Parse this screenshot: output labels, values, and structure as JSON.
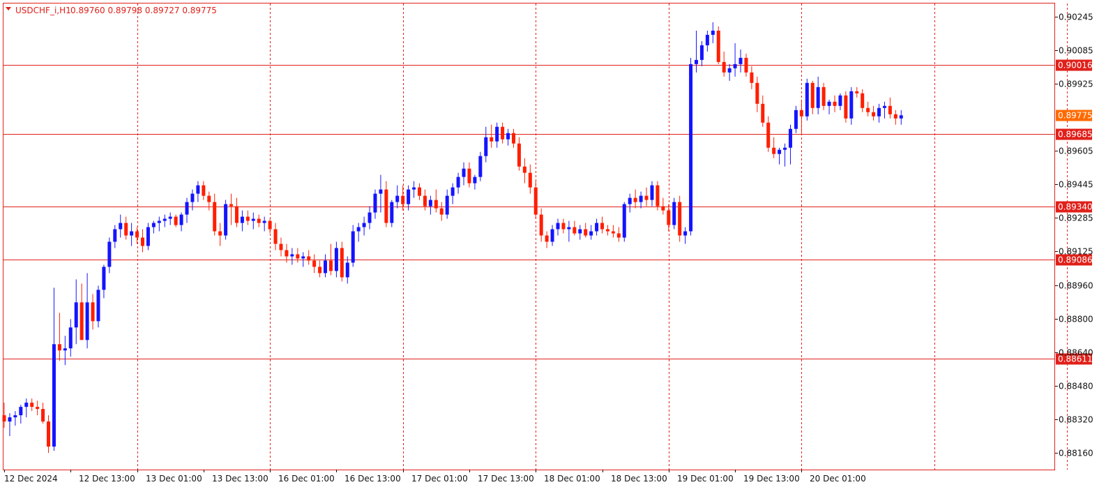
{
  "header": {
    "symbol": "USDCHF_i,H1",
    "ohlc": "0.89760 0.89798 0.89727 0.89775"
  },
  "colors": {
    "frame": "#e0201a",
    "grid": "#e0201a",
    "bull": "#1414ff",
    "bear": "#ff1e00",
    "label_text": "#ffffff",
    "background": "#ffffff"
  },
  "chart_data": {
    "type": "candlestick",
    "symbol": "USDCHF_i",
    "timeframe": "H1",
    "ylim": [
      0.8808,
      0.9031
    ],
    "y_ticks": [
      "0.90245",
      "0.90085",
      "0.89925",
      "0.89605",
      "0.89445",
      "0.89285",
      "0.89125",
      "0.88960",
      "0.88800",
      "0.88640",
      "0.88480",
      "0.88320",
      "0.88160"
    ],
    "x_labels": [
      "12 Dec 2024",
      "12 Dec 13:00",
      "13 Dec 01:00",
      "13 Dec 13:00",
      "16 Dec 01:00",
      "16 Dec 13:00",
      "17 Dec 01:00",
      "17 Dec 13:00",
      "18 Dec 01:00",
      "18 Dec 13:00",
      "19 Dec 01:00",
      "19 Dec 13:00",
      "20 Dec 01:00"
    ],
    "vertical_grid_bars": [
      24,
      48,
      72,
      96,
      120,
      144,
      168,
      192
    ],
    "horizontal_lines": [
      0.90016,
      0.89685,
      0.8934,
      0.89086,
      0.88611
    ],
    "current_price": 0.89775,
    "grid": "vertical dotted",
    "candles": [
      [
        0.8834,
        0.884,
        0.8828,
        0.8831
      ],
      [
        0.8831,
        0.8835,
        0.8824,
        0.8833
      ],
      [
        0.8833,
        0.8836,
        0.8829,
        0.8834
      ],
      [
        0.8834,
        0.8839,
        0.883,
        0.8838
      ],
      [
        0.8838,
        0.8842,
        0.8833,
        0.884
      ],
      [
        0.884,
        0.8842,
        0.8836,
        0.8838
      ],
      [
        0.8838,
        0.8841,
        0.8834,
        0.8837
      ],
      [
        0.8837,
        0.884,
        0.883,
        0.8831
      ],
      [
        0.8831,
        0.8834,
        0.8816,
        0.8819
      ],
      [
        0.8819,
        0.8895,
        0.8817,
        0.8868
      ],
      [
        0.8868,
        0.8883,
        0.886,
        0.8865
      ],
      [
        0.8865,
        0.8872,
        0.8858,
        0.8866
      ],
      [
        0.8866,
        0.888,
        0.8862,
        0.8876
      ],
      [
        0.8876,
        0.8899,
        0.8868,
        0.8888
      ],
      [
        0.8888,
        0.8897,
        0.8871,
        0.887
      ],
      [
        0.887,
        0.8902,
        0.8866,
        0.8888
      ],
      [
        0.8888,
        0.8892,
        0.8875,
        0.8879
      ],
      [
        0.8879,
        0.8896,
        0.8876,
        0.8894
      ],
      [
        0.8894,
        0.8906,
        0.889,
        0.8905
      ],
      [
        0.8905,
        0.8919,
        0.8902,
        0.8917
      ],
      [
        0.8917,
        0.8925,
        0.8914,
        0.8923
      ],
      [
        0.8923,
        0.893,
        0.8919,
        0.8926
      ],
      [
        0.8926,
        0.8929,
        0.8918,
        0.892
      ],
      [
        0.892,
        0.8926,
        0.8915,
        0.8922
      ],
      [
        0.8922,
        0.8924,
        0.8916,
        0.8919
      ],
      [
        0.8919,
        0.8923,
        0.8912,
        0.8915
      ],
      [
        0.8915,
        0.8926,
        0.8913,
        0.8924
      ],
      [
        0.8924,
        0.8927,
        0.8921,
        0.8926
      ],
      [
        0.8926,
        0.8929,
        0.8922,
        0.8927
      ],
      [
        0.8927,
        0.893,
        0.8924,
        0.8928
      ],
      [
        0.8928,
        0.8931,
        0.8925,
        0.8929
      ],
      [
        0.8929,
        0.893,
        0.8924,
        0.8925
      ],
      [
        0.8925,
        0.8931,
        0.8922,
        0.893
      ],
      [
        0.893,
        0.8938,
        0.8926,
        0.8936
      ],
      [
        0.8936,
        0.8942,
        0.8932,
        0.894
      ],
      [
        0.894,
        0.8946,
        0.8936,
        0.8944
      ],
      [
        0.8944,
        0.8946,
        0.8937,
        0.8939
      ],
      [
        0.8939,
        0.8941,
        0.8932,
        0.8936
      ],
      [
        0.8936,
        0.894,
        0.892,
        0.8922
      ],
      [
        0.8922,
        0.8926,
        0.8915,
        0.892
      ],
      [
        0.892,
        0.8937,
        0.8918,
        0.8935
      ],
      [
        0.8935,
        0.894,
        0.8925,
        0.8934
      ],
      [
        0.8934,
        0.8938,
        0.8924,
        0.8926
      ],
      [
        0.8926,
        0.8932,
        0.8922,
        0.8929
      ],
      [
        0.8929,
        0.8932,
        0.8925,
        0.8927
      ],
      [
        0.8927,
        0.8931,
        0.8923,
        0.8928
      ],
      [
        0.8928,
        0.893,
        0.8924,
        0.8926
      ],
      [
        0.8926,
        0.8929,
        0.8922,
        0.8927
      ],
      [
        0.8927,
        0.8928,
        0.8921,
        0.8923
      ],
      [
        0.8923,
        0.8926,
        0.8913,
        0.8916
      ],
      [
        0.8916,
        0.8919,
        0.891,
        0.8913
      ],
      [
        0.8913,
        0.8916,
        0.8907,
        0.891
      ],
      [
        0.891,
        0.8914,
        0.8906,
        0.8911
      ],
      [
        0.8911,
        0.8914,
        0.8907,
        0.8909
      ],
      [
        0.8909,
        0.8912,
        0.8905,
        0.891
      ],
      [
        0.891,
        0.8913,
        0.8906,
        0.8908
      ],
      [
        0.8908,
        0.8911,
        0.8902,
        0.8905
      ],
      [
        0.8905,
        0.8908,
        0.89,
        0.8902
      ],
      [
        0.8902,
        0.8911,
        0.89,
        0.8908
      ],
      [
        0.8908,
        0.8916,
        0.8901,
        0.8903
      ],
      [
        0.8903,
        0.8917,
        0.89,
        0.8914
      ],
      [
        0.8914,
        0.8917,
        0.8898,
        0.89
      ],
      [
        0.89,
        0.891,
        0.8897,
        0.8907
      ],
      [
        0.8907,
        0.8925,
        0.8905,
        0.8922
      ],
      [
        0.8922,
        0.8926,
        0.8917,
        0.8924
      ],
      [
        0.8924,
        0.8929,
        0.892,
        0.8926
      ],
      [
        0.8926,
        0.8934,
        0.8923,
        0.8931
      ],
      [
        0.8931,
        0.8942,
        0.8928,
        0.894
      ],
      [
        0.894,
        0.8949,
        0.8931,
        0.8942
      ],
      [
        0.8942,
        0.8946,
        0.8924,
        0.8926
      ],
      [
        0.8926,
        0.8937,
        0.8924,
        0.8936
      ],
      [
        0.8936,
        0.8944,
        0.8933,
        0.8939
      ],
      [
        0.8939,
        0.8944,
        0.8932,
        0.8935
      ],
      [
        0.8935,
        0.8944,
        0.8932,
        0.8942
      ],
      [
        0.8942,
        0.8946,
        0.8938,
        0.8943
      ],
      [
        0.8943,
        0.8945,
        0.8937,
        0.8939
      ],
      [
        0.8939,
        0.8942,
        0.8932,
        0.8934
      ],
      [
        0.8934,
        0.8939,
        0.893,
        0.8937
      ],
      [
        0.8937,
        0.8942,
        0.8931,
        0.8933
      ],
      [
        0.8933,
        0.8936,
        0.8927,
        0.893
      ],
      [
        0.893,
        0.8942,
        0.8928,
        0.8939
      ],
      [
        0.8939,
        0.8945,
        0.8935,
        0.8943
      ],
      [
        0.8943,
        0.895,
        0.894,
        0.8948
      ],
      [
        0.8948,
        0.8955,
        0.8944,
        0.8952
      ],
      [
        0.8952,
        0.8955,
        0.8943,
        0.8945
      ],
      [
        0.8945,
        0.8949,
        0.8942,
        0.8948
      ],
      [
        0.8948,
        0.896,
        0.8946,
        0.8958
      ],
      [
        0.8958,
        0.8972,
        0.8955,
        0.8967
      ],
      [
        0.8967,
        0.8973,
        0.8962,
        0.8965
      ],
      [
        0.8965,
        0.8974,
        0.8962,
        0.8972
      ],
      [
        0.8972,
        0.8974,
        0.8964,
        0.8966
      ],
      [
        0.8966,
        0.8971,
        0.8963,
        0.8969
      ],
      [
        0.8969,
        0.8971,
        0.8962,
        0.8964
      ],
      [
        0.8964,
        0.8967,
        0.8951,
        0.8953
      ],
      [
        0.8953,
        0.8957,
        0.8945,
        0.895
      ],
      [
        0.895,
        0.8954,
        0.894,
        0.8943
      ],
      [
        0.8943,
        0.8946,
        0.8928,
        0.893
      ],
      [
        0.893,
        0.8933,
        0.8917,
        0.892
      ],
      [
        0.892,
        0.8922,
        0.8914,
        0.8917
      ],
      [
        0.8917,
        0.8925,
        0.8915,
        0.8923
      ],
      [
        0.8923,
        0.8928,
        0.892,
        0.8926
      ],
      [
        0.8926,
        0.8928,
        0.8921,
        0.8923
      ],
      [
        0.8923,
        0.8927,
        0.8917,
        0.8924
      ],
      [
        0.8924,
        0.8927,
        0.892,
        0.8921
      ],
      [
        0.8921,
        0.8925,
        0.8918,
        0.8923
      ],
      [
        0.8923,
        0.8926,
        0.8919,
        0.892
      ],
      [
        0.892,
        0.8925,
        0.8918,
        0.8922
      ],
      [
        0.8922,
        0.8928,
        0.892,
        0.8926
      ],
      [
        0.8926,
        0.8929,
        0.8921,
        0.8923
      ],
      [
        0.8923,
        0.8925,
        0.892,
        0.8922
      ],
      [
        0.8922,
        0.8925,
        0.8919,
        0.8921
      ],
      [
        0.8921,
        0.8924,
        0.8917,
        0.8919
      ],
      [
        0.8919,
        0.8936,
        0.8917,
        0.8935
      ],
      [
        0.8935,
        0.894,
        0.8931,
        0.8938
      ],
      [
        0.8938,
        0.8942,
        0.8933,
        0.8936
      ],
      [
        0.8936,
        0.8941,
        0.8933,
        0.8939
      ],
      [
        0.8939,
        0.8943,
        0.8934,
        0.8937
      ],
      [
        0.8937,
        0.8946,
        0.8934,
        0.8944
      ],
      [
        0.8944,
        0.8946,
        0.8932,
        0.8934
      ],
      [
        0.8934,
        0.8938,
        0.893,
        0.8932
      ],
      [
        0.8932,
        0.8935,
        0.8922,
        0.8925
      ],
      [
        0.8925,
        0.8938,
        0.8923,
        0.8936
      ],
      [
        0.8936,
        0.8939,
        0.8917,
        0.892
      ],
      [
        0.892,
        0.8924,
        0.8916,
        0.8922
      ],
      [
        0.8922,
        0.9005,
        0.892,
        0.9002
      ],
      [
        0.9002,
        0.9018,
        0.8998,
        0.9004
      ],
      [
        0.9004,
        0.9013,
        0.9001,
        0.9011
      ],
      [
        0.9011,
        0.9018,
        0.9008,
        0.9016
      ],
      [
        0.9016,
        0.9022,
        0.9012,
        0.9018
      ],
      [
        0.9018,
        0.902,
        0.9002,
        0.9003
      ],
      [
        0.9003,
        0.9008,
        0.8996,
        0.8998
      ],
      [
        0.8998,
        0.9002,
        0.8994,
        0.9
      ],
      [
        0.9,
        0.9012,
        0.8996,
        0.9002
      ],
      [
        0.9002,
        0.9009,
        0.8998,
        0.9005
      ],
      [
        0.9005,
        0.9007,
        0.8996,
        0.8998
      ],
      [
        0.8998,
        0.9001,
        0.899,
        0.8993
      ],
      [
        0.8993,
        0.8996,
        0.8979,
        0.8983
      ],
      [
        0.8983,
        0.8987,
        0.8972,
        0.8974
      ],
      [
        0.8974,
        0.8977,
        0.896,
        0.8962
      ],
      [
        0.8962,
        0.8967,
        0.8957,
        0.8959
      ],
      [
        0.8959,
        0.8962,
        0.8954,
        0.8961
      ],
      [
        0.8961,
        0.8964,
        0.8953,
        0.8962
      ],
      [
        0.8962,
        0.8973,
        0.8954,
        0.8971
      ],
      [
        0.8971,
        0.8982,
        0.8969,
        0.898
      ],
      [
        0.898,
        0.8985,
        0.8968,
        0.8977
      ],
      [
        0.8977,
        0.8995,
        0.8975,
        0.8993
      ],
      [
        0.8993,
        0.8994,
        0.8978,
        0.8981
      ],
      [
        0.8981,
        0.8996,
        0.8978,
        0.8991
      ],
      [
        0.8991,
        0.8993,
        0.898,
        0.8982
      ],
      [
        0.8982,
        0.8985,
        0.8978,
        0.8984
      ],
      [
        0.8984,
        0.8987,
        0.8979,
        0.8982
      ],
      [
        0.8982,
        0.8988,
        0.898,
        0.8987
      ],
      [
        0.8987,
        0.8989,
        0.8974,
        0.8976
      ],
      [
        0.8976,
        0.8991,
        0.8973,
        0.8989
      ],
      [
        0.8989,
        0.8991,
        0.8986,
        0.8988
      ],
      [
        0.8988,
        0.899,
        0.8979,
        0.8981
      ],
      [
        0.8981,
        0.8984,
        0.8977,
        0.8979
      ],
      [
        0.8979,
        0.8982,
        0.8975,
        0.8977
      ],
      [
        0.8977,
        0.8983,
        0.8974,
        0.8981
      ],
      [
        0.8981,
        0.8984,
        0.8976,
        0.8982
      ],
      [
        0.8982,
        0.8986,
        0.8976,
        0.8978
      ],
      [
        0.8978,
        0.898,
        0.8973,
        0.8976
      ],
      [
        0.8976,
        0.898,
        0.8973,
        0.89775
      ]
    ]
  }
}
